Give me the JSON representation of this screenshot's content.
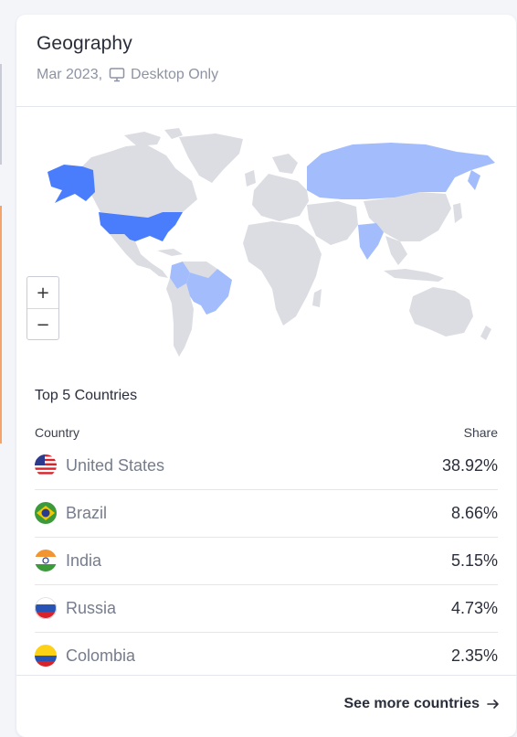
{
  "card": {
    "title": "Geography",
    "period": "Mar 2023,",
    "device": "Desktop Only",
    "device_icon": "monitor-icon"
  },
  "map": {
    "zoom_in": "+",
    "zoom_out": "−",
    "base_color": "#dcdde2",
    "highlight_strong": "#4a7dfc",
    "highlight_light": "#a3bcfb"
  },
  "top_countries": {
    "title": "Top 5 Countries",
    "col_country": "Country",
    "col_share": "Share",
    "rows": [
      {
        "country": "United States",
        "share": "38.92%",
        "flag": "flag-us-icon"
      },
      {
        "country": "Brazil",
        "share": "8.66%",
        "flag": "flag-br-icon"
      },
      {
        "country": "India",
        "share": "5.15%",
        "flag": "flag-in-icon"
      },
      {
        "country": "Russia",
        "share": "4.73%",
        "flag": "flag-ru-icon"
      },
      {
        "country": "Colombia",
        "share": "2.35%",
        "flag": "flag-co-icon"
      }
    ]
  },
  "footer": {
    "link": "See more countries",
    "icon": "arrow-right-icon"
  }
}
